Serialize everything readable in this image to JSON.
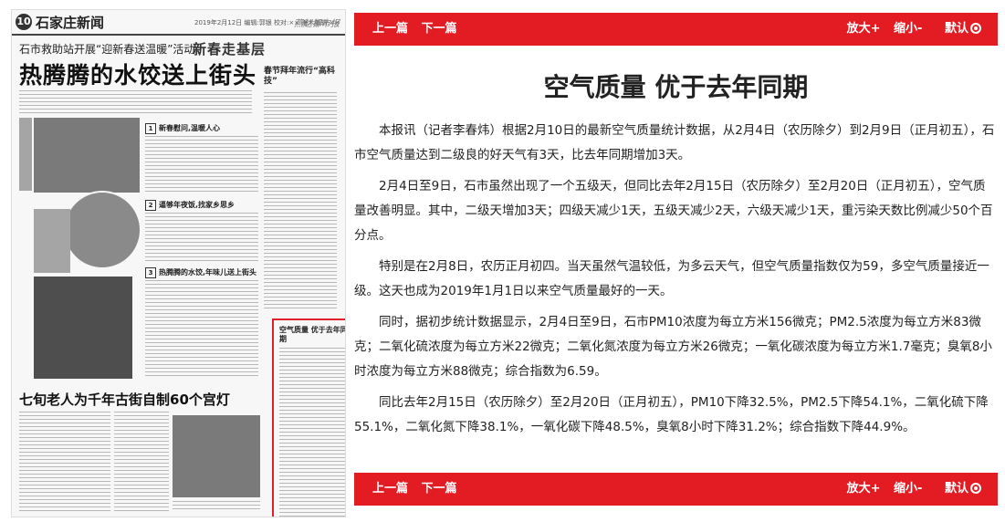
{
  "newspaper": {
    "page_number": "10",
    "section_title": "石家庄新闻",
    "meta": "2019年2月12日  编辑:郭银 校对:×× 美术编辑:××",
    "logo": "燕赵都市报",
    "sub_headline": "石市救助站开展“迎新春送温暖”活动",
    "stamp": "新春走基层",
    "main_headline": "热腾腾的水饺送上街头",
    "side_kicker": "春节拜年流行“高科技”",
    "sections": [
      {
        "num": "1",
        "label": "新春慰问,温暖人心"
      },
      {
        "num": "2",
        "label": "逼够年夜饭,找家乡思乡"
      },
      {
        "num": "3",
        "label": "热腾腾的水饺,年味儿送上街头"
      }
    ],
    "highlight_title": "空气质量 优于去年同期",
    "bottom_headline": "七旬老人为千年古街自制60个宫灯"
  },
  "nav": {
    "prev": "上一篇",
    "next": "下一篇",
    "zoom_in": "放大+",
    "zoom_out": "缩小-",
    "default": "默认"
  },
  "article": {
    "title": "空气质量 优于去年同期",
    "paragraphs": [
      "本报讯（记者李春炜）根据2月10日的最新空气质量统计数据，从2月4日（农历除夕）到2月9日（正月初五），石市空气质量达到二级良的好天气有3天，比去年同期增加3天。",
      "2月4日至9日，石市虽然出现了一个五级天，但同比去年2月15日（农历除夕）至2月20日（正月初五），空气质量改善明显。其中，二级天增加3天；四级天减少1天，五级天减少2天，六级天减少1天，重污染天数比例减少50个百分点。",
      "特别是在2月8日，农历正月初四。当天虽然气温较低，为多云天气，但空气质量指数仅为59，多空气质量接近一级。这天也成为2019年1月1日以来空气质量最好的一天。",
      "同时，据初步统计数据显示，2月4日至9日，石市PM10浓度为每立方米156微克；PM2.5浓度为每立方米83微克；二氧化硫浓度为每立方米22微克；二氧化氮浓度为每立方米26微克；一氧化碳浓度为每立方米1.7毫克；臭氧8小时浓度为每立方米88微克；综合指数为6.59。",
      "同比去年2月15日（农历除夕）至2月20日（正月初五），PM10下降32.5%，PM2.5下降54.1%，二氧化硫下降55.1%，二氧化氮下降38.1%，一氧化碳下降48.5%，臭氧8小时下降31.2%；综合指数下降44.9%。"
    ]
  },
  "colors": {
    "accent": "#e31b23",
    "highlight_border": "#e0202a",
    "text": "#222222"
  }
}
